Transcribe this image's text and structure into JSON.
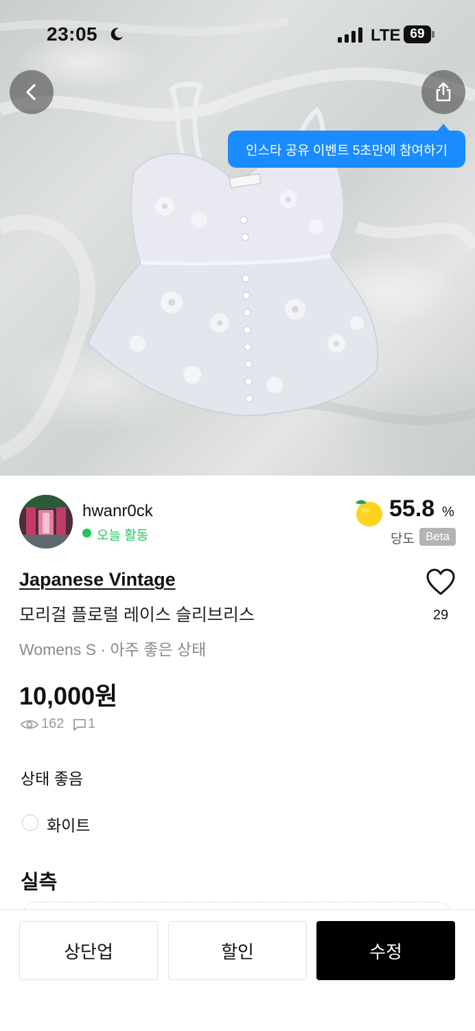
{
  "status_bar": {
    "time": "23:05",
    "network": "LTE",
    "battery": "69"
  },
  "hero": {
    "tooltip": "인스타 공유 이벤트 5초만에 참여하기"
  },
  "seller": {
    "name": "hwanr0ck",
    "activity": "오늘 활동"
  },
  "lemon_score": {
    "value": "55.8",
    "unit": "%",
    "label": "당도",
    "badge": "Beta"
  },
  "product": {
    "brand": "Japanese Vintage",
    "title": "모리걸 플로럴 레이스 슬리브리스",
    "meta": "Womens S · 아주 좋은 상태",
    "likes": "29",
    "price": "10,000원",
    "views": "162",
    "chats": "1",
    "condition": "상태 좋음",
    "color": "화이트",
    "size_heading": "실측"
  },
  "actions": {
    "bump": "상단업",
    "discount": "할인",
    "edit": "수정"
  },
  "colors": {
    "accent_blue": "#1a8cff",
    "active_green": "#22c55e",
    "primary_black": "#000000"
  }
}
